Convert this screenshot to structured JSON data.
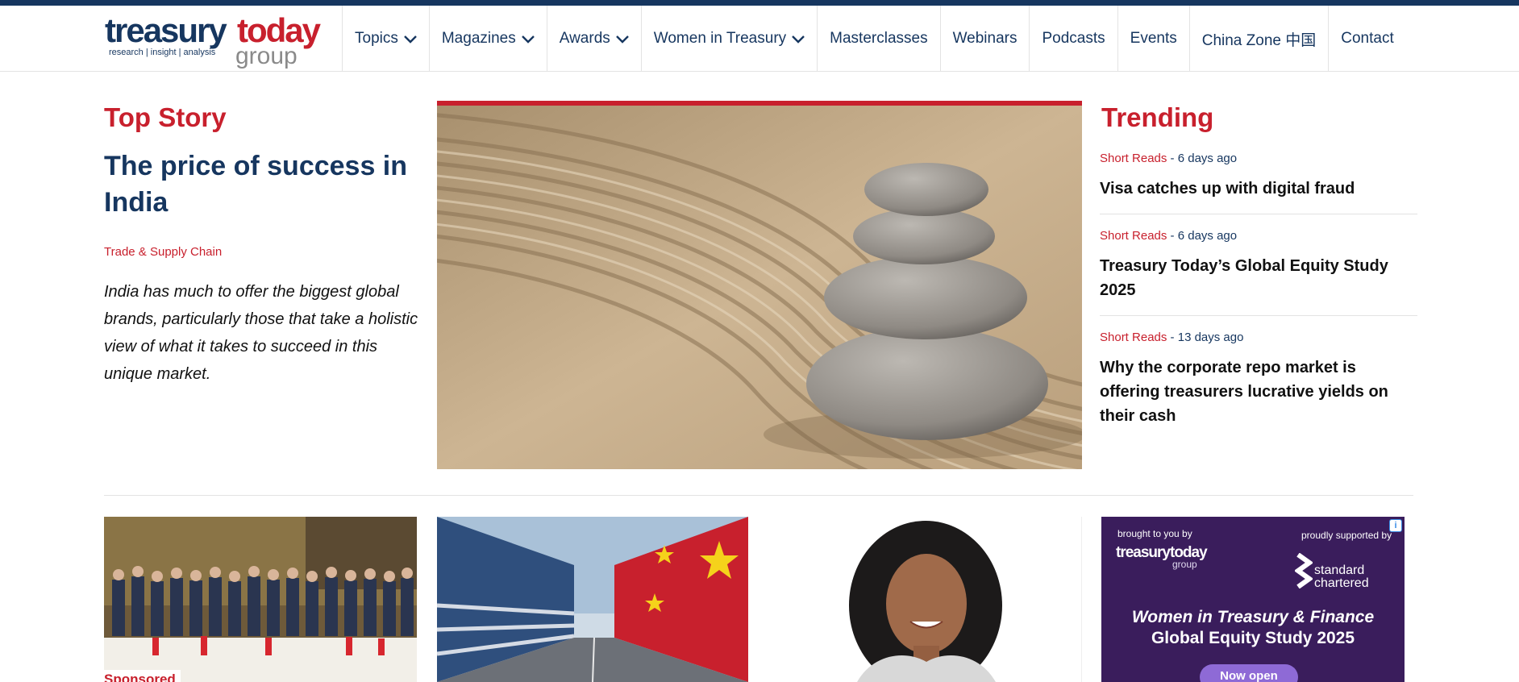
{
  "brand": {
    "logo_word_1": "treasury",
    "logo_word_2": "today",
    "logo_tagline": "research | insight | analysis",
    "logo_group": "group",
    "colors": {
      "navy": "#16365f",
      "red": "#c8202d",
      "grey": "#8a8a8a"
    }
  },
  "nav": {
    "items": [
      {
        "label": "Topics",
        "dropdown": true
      },
      {
        "label": "Magazines",
        "dropdown": true
      },
      {
        "label": "Awards",
        "dropdown": true
      },
      {
        "label": "Women in Treasury",
        "dropdown": true
      },
      {
        "label": "Masterclasses",
        "dropdown": false
      },
      {
        "label": "Webinars",
        "dropdown": false
      },
      {
        "label": "Podcasts",
        "dropdown": false
      },
      {
        "label": "Events",
        "dropdown": false
      },
      {
        "label": "China Zone 中国",
        "dropdown": false
      },
      {
        "label": "Contact",
        "dropdown": false
      }
    ]
  },
  "top_story": {
    "section_title": "Top Story",
    "headline": "The price of success in India",
    "category": "Trade & Supply Chain",
    "summary": "India has much to offer the biggest global brands, particularly those that take a holistic view of what it takes to succeed in this unique market."
  },
  "trending": {
    "section_title": "Trending",
    "items": [
      {
        "category": "Short Reads",
        "ago": " - 6 days ago",
        "title": "Visa catches up with digital fraud"
      },
      {
        "category": "Short Reads",
        "ago": " - 6 days ago",
        "title": "Treasury Today’s Global Equity Study 2025"
      },
      {
        "category": "Short Reads",
        "ago": " - 13 days ago",
        "title": "Why the corporate repo market is offering treasurers lucrative yields on their cash"
      }
    ]
  },
  "cards": {
    "card1_badge": "Sponsored"
  },
  "ad": {
    "brought_by": "brought to you by",
    "supported_by": "proudly supported by",
    "logo": "treasurytoday",
    "logo_sub": "group",
    "sc_line1": "standard",
    "sc_line2": "chartered",
    "headline_line1": "Women in Treasury & Finance",
    "headline_line2": "Global Equity Study 2025",
    "button": "Now open",
    "info_icon": "i"
  }
}
